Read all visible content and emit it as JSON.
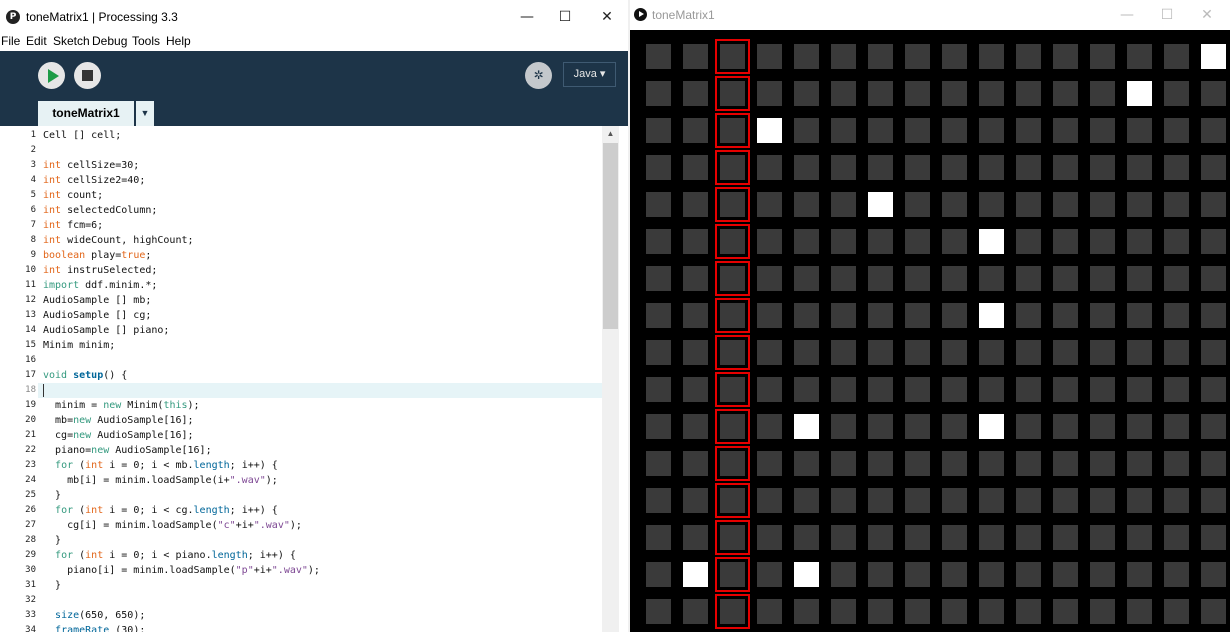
{
  "ide": {
    "title": "toneMatrix1 | Processing 3.3",
    "logo": "P",
    "menu": [
      "File",
      "Edit",
      "Sketch",
      "Debug",
      "Tools",
      "Help"
    ],
    "mode": "Java ▾",
    "tab": "toneMatrix1",
    "tab_menu": "▼",
    "window_buttons": {
      "minimize": "—",
      "maximize": "☐",
      "close": "✕"
    },
    "current_line": 18,
    "code": [
      [
        [
          "t",
          "Cell [] cell;"
        ]
      ],
      [],
      [
        [
          "k",
          "int"
        ],
        [
          "t",
          " cellSize=30;"
        ]
      ],
      [
        [
          "k",
          "int"
        ],
        [
          "t",
          " cellSize2=40;"
        ]
      ],
      [
        [
          "k",
          "int"
        ],
        [
          "t",
          " count;"
        ]
      ],
      [
        [
          "k",
          "int"
        ],
        [
          "t",
          " selectedColumn;"
        ]
      ],
      [
        [
          "k",
          "int"
        ],
        [
          "t",
          " fcm=6;"
        ]
      ],
      [
        [
          "k",
          "int"
        ],
        [
          "t",
          " wideCount, highCount;"
        ]
      ],
      [
        [
          "k",
          "boolean"
        ],
        [
          "t",
          " play="
        ],
        [
          "k",
          "true"
        ],
        [
          "t",
          ";"
        ]
      ],
      [
        [
          "k",
          "int"
        ],
        [
          "t",
          " instruSelected;"
        ]
      ],
      [
        [
          "b",
          "import"
        ],
        [
          "t",
          " ddf.minim.*;"
        ]
      ],
      [
        [
          "t",
          "AudioSample [] mb;"
        ]
      ],
      [
        [
          "t",
          "AudioSample [] cg;"
        ]
      ],
      [
        [
          "t",
          "AudioSample [] piano;"
        ]
      ],
      [
        [
          "t",
          "Minim minim;"
        ]
      ],
      [],
      [
        [
          "b",
          "void"
        ],
        [
          "t",
          " "
        ],
        [
          "f",
          "setup"
        ],
        [
          "t",
          "() {"
        ]
      ],
      [],
      [
        [
          "t",
          "  minim = "
        ],
        [
          "b",
          "new"
        ],
        [
          "t",
          " Minim("
        ],
        [
          "b",
          "this"
        ],
        [
          "t",
          ");"
        ]
      ],
      [
        [
          "t",
          "  mb="
        ],
        [
          "b",
          "new"
        ],
        [
          "t",
          " AudioSample[16];"
        ]
      ],
      [
        [
          "t",
          "  cg="
        ],
        [
          "b",
          "new"
        ],
        [
          "t",
          " AudioSample[16];"
        ]
      ],
      [
        [
          "t",
          "  piano="
        ],
        [
          "b",
          "new"
        ],
        [
          "t",
          " AudioSample[16];"
        ]
      ],
      [
        [
          "t",
          "  "
        ],
        [
          "b",
          "for"
        ],
        [
          "t",
          " ("
        ],
        [
          "k",
          "int"
        ],
        [
          "t",
          " i = 0; i < mb."
        ],
        [
          "c",
          "length"
        ],
        [
          "t",
          "; i++) {"
        ]
      ],
      [
        [
          "t",
          "    mb[i] = minim.loadSample(i+"
        ],
        [
          "s",
          "\".wav\""
        ],
        [
          "t",
          ");"
        ]
      ],
      [
        [
          "t",
          "  }"
        ]
      ],
      [
        [
          "t",
          "  "
        ],
        [
          "b",
          "for"
        ],
        [
          "t",
          " ("
        ],
        [
          "k",
          "int"
        ],
        [
          "t",
          " i = 0; i < cg."
        ],
        [
          "c",
          "length"
        ],
        [
          "t",
          "; i++) {"
        ]
      ],
      [
        [
          "t",
          "    cg[i] = minim.loadSample("
        ],
        [
          "s",
          "\"c\""
        ],
        [
          "t",
          "+i+"
        ],
        [
          "s",
          "\".wav\""
        ],
        [
          "t",
          ");"
        ]
      ],
      [
        [
          "t",
          "  }"
        ]
      ],
      [
        [
          "t",
          "  "
        ],
        [
          "b",
          "for"
        ],
        [
          "t",
          " ("
        ],
        [
          "k",
          "int"
        ],
        [
          "t",
          " i = 0; i < piano."
        ],
        [
          "c",
          "length"
        ],
        [
          "t",
          "; i++) {"
        ]
      ],
      [
        [
          "t",
          "    piano[i] = minim.loadSample("
        ],
        [
          "s",
          "\"p\""
        ],
        [
          "t",
          "+i+"
        ],
        [
          "s",
          "\".wav\""
        ],
        [
          "t",
          ");"
        ]
      ],
      [
        [
          "t",
          "  }"
        ]
      ],
      [],
      [
        [
          "t",
          "  "
        ],
        [
          "c",
          "size"
        ],
        [
          "t",
          "(650, 650);"
        ]
      ],
      [
        [
          "t",
          "  "
        ],
        [
          "c",
          "frameRate"
        ],
        [
          "t",
          " (30);"
        ]
      ]
    ]
  },
  "sketch": {
    "title": "toneMatrix1",
    "window_buttons": {
      "minimize": "—",
      "maximize": "☐",
      "close": "✕"
    },
    "grid": {
      "columns": 16,
      "rows": 16,
      "selected_column": 2,
      "active_cells": [
        [
          1,
          14
        ],
        [
          3,
          2
        ],
        [
          4,
          10
        ],
        [
          4,
          14
        ],
        [
          6,
          4
        ],
        [
          9,
          5
        ],
        [
          9,
          7
        ],
        [
          9,
          10
        ],
        [
          13,
          1
        ],
        [
          15,
          0
        ]
      ],
      "colors": {
        "off": "#3a3a3a",
        "on": "#ffffff",
        "selected": "#e60000",
        "background": "#000000"
      }
    }
  },
  "colors": {
    "toolbar": "#1d3448",
    "keyword": "#e2661a",
    "function": "#006699",
    "keyword2": "#33997e",
    "string": "#7d4793"
  },
  "icons": {
    "run": "play-icon",
    "stop": "stop-icon",
    "debug": "debugger-icon"
  }
}
